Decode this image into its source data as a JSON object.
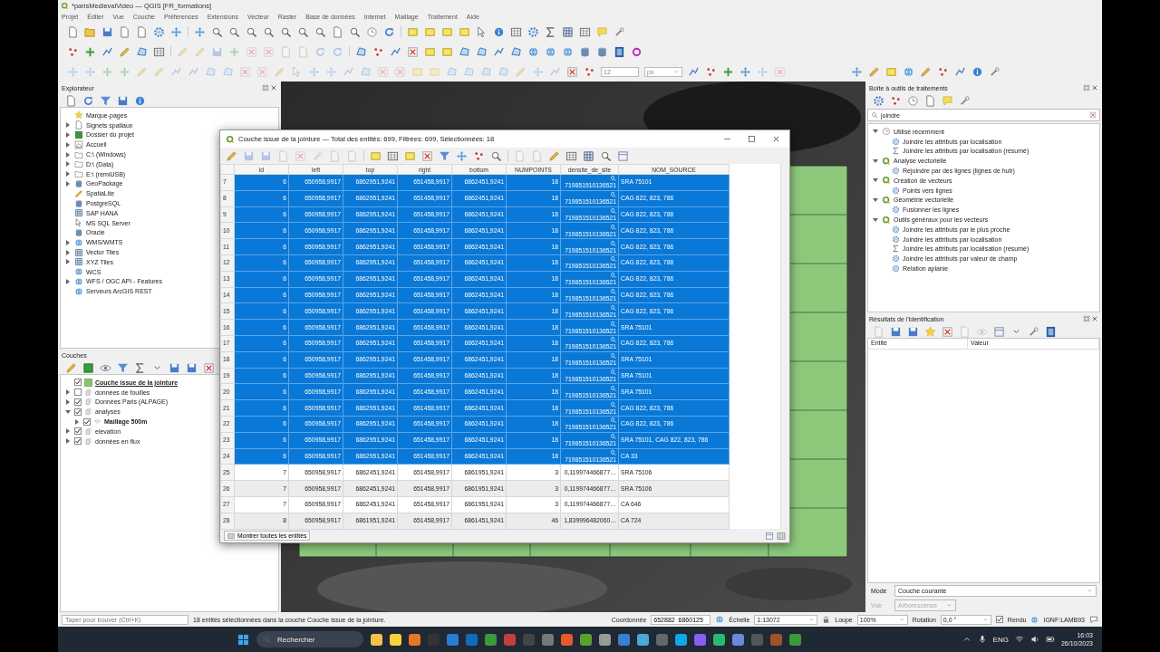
{
  "window": {
    "title": "*parisMedievalVideo — QGIS [FR_formations]"
  },
  "menu": [
    "Projet",
    "Éditer",
    "Vue",
    "Couche",
    "Préférences",
    "Extensions",
    "Vecteur",
    "Raster",
    "Base de données",
    "Internet",
    "Maillage",
    "Traitement",
    "Aide"
  ],
  "toolbar": {
    "size_value": "12",
    "unit": "px"
  },
  "browser": {
    "title": "Explorateur",
    "items": [
      {
        "label": "Marque-pages",
        "kind": "star"
      },
      {
        "label": "Signets spatiaux",
        "kind": "doc",
        "expanded": false
      },
      {
        "label": "Dossier du projet",
        "kind": "layer",
        "expanded": false
      },
      {
        "label": "Accueil",
        "kind": "home",
        "expanded": false
      },
      {
        "label": "C:\\ (Windows)",
        "kind": "drive",
        "expanded": false
      },
      {
        "label": "D:\\ (Data)",
        "kind": "drive",
        "expanded": false
      },
      {
        "label": "E:\\ (remiUSB)",
        "kind": "drive",
        "expanded": false
      },
      {
        "label": "GeoPackage",
        "kind": "db",
        "expanded": false
      },
      {
        "label": "SpatiaLite",
        "kind": "pencil"
      },
      {
        "label": "PostgreSQL",
        "kind": "db"
      },
      {
        "label": "SAP HANA",
        "kind": "grid"
      },
      {
        "label": "MS SQL Server",
        "kind": "cursor"
      },
      {
        "label": "Oracle",
        "kind": "db"
      },
      {
        "label": "WMS/WMTS",
        "kind": "globe",
        "expanded": false
      },
      {
        "label": "Vector Tiles",
        "kind": "grid",
        "expanded": false
      },
      {
        "label": "XYZ Tiles",
        "kind": "grid",
        "expanded": false
      },
      {
        "label": "WCS",
        "kind": "globe"
      },
      {
        "label": "WFS / OGC API - Features",
        "kind": "globe",
        "expanded": false
      },
      {
        "label": "Serveurs ArcGIS REST",
        "kind": "globe"
      }
    ]
  },
  "layers": {
    "title": "Couches",
    "items": [
      {
        "label": "Couche issue de la jointure",
        "kind": "fill",
        "checked": true,
        "selected": true
      },
      {
        "label": "données de fouilles",
        "kind": "group",
        "checked": false,
        "selected": false,
        "expanded": false
      },
      {
        "label": "Données Paris (ALPAGE)",
        "kind": "group",
        "checked": true,
        "selected": false,
        "expanded": false
      },
      {
        "label": "analyses",
        "kind": "group",
        "checked": true,
        "selected": false,
        "expanded": true,
        "children": [
          {
            "label": "Maillage 500m",
            "kind": "mesh",
            "checked": true,
            "selected": false,
            "bold": true,
            "expanded": false
          }
        ]
      },
      {
        "label": "elevation",
        "kind": "group",
        "checked": true,
        "selected": false,
        "expanded": false
      },
      {
        "label": "données en flux",
        "kind": "group",
        "checked": true,
        "selected": false,
        "expanded": false
      }
    ]
  },
  "attribute_table": {
    "title": "Couche issue de la jointure — Total des entités: 699, Filtrées: 699, Sélectionnées: 18",
    "columns": [
      "id",
      "left",
      "top",
      "right",
      "bottom",
      "NUMPOINTS",
      "densite_de_site",
      "NOM_SOURCE"
    ],
    "rows": [
      {
        "number": "7",
        "selected": true,
        "cells": [
          "6",
          "650958,9917",
          "6862951,9241",
          "651458,9917",
          "6862451,9241",
          "18",
          "0,719851510136521",
          "SRA 75101"
        ]
      },
      {
        "number": "8",
        "selected": true,
        "cells": [
          "6",
          "650958,9917",
          "6862951,9241",
          "651458,9917",
          "6862451,9241",
          "18",
          "0,719851510136521",
          "CAG 822, 823, 786"
        ]
      },
      {
        "number": "9",
        "selected": true,
        "cells": [
          "6",
          "650958,9917",
          "6862951,9241",
          "651458,9917",
          "6862451,9241",
          "18",
          "0,719851510136521",
          "CAG 822, 823, 786"
        ]
      },
      {
        "number": "10",
        "selected": true,
        "cells": [
          "6",
          "650958,9917",
          "6862951,9241",
          "651458,9917",
          "6862451,9241",
          "18",
          "0,719851510136521",
          "CAG 822, 823, 786"
        ]
      },
      {
        "number": "11",
        "selected": true,
        "cells": [
          "6",
          "650958,9917",
          "6862951,9241",
          "651458,9917",
          "6862451,9241",
          "18",
          "0,719851510136521",
          "CAG 822, 823, 786"
        ]
      },
      {
        "number": "12",
        "selected": true,
        "cells": [
          "6",
          "650958,9917",
          "6862951,9241",
          "651458,9917",
          "6862451,9241",
          "18",
          "0,719851510136521",
          "CAG 822, 823, 786"
        ]
      },
      {
        "number": "13",
        "selected": true,
        "cells": [
          "6",
          "650958,9917",
          "6862951,9241",
          "651458,9917",
          "6862451,9241",
          "18",
          "0,719851510136521",
          "CAG 822, 823, 786"
        ]
      },
      {
        "number": "14",
        "selected": true,
        "cells": [
          "6",
          "650958,9917",
          "6862951,9241",
          "651458,9917",
          "6862451,9241",
          "18",
          "0,719851510136521",
          "CAG 822, 823, 786"
        ]
      },
      {
        "number": "15",
        "selected": true,
        "cells": [
          "6",
          "650958,9917",
          "6862951,9241",
          "651458,9917",
          "6862451,9241",
          "18",
          "0,719851510136521",
          "CAG 822, 823, 786"
        ]
      },
      {
        "number": "16",
        "selected": true,
        "cells": [
          "6",
          "650958,9917",
          "6862951,9241",
          "651458,9917",
          "6862451,9241",
          "18",
          "0,719851510136521",
          "SRA 75101"
        ]
      },
      {
        "number": "17",
        "selected": true,
        "cells": [
          "6",
          "650958,9917",
          "6862951,9241",
          "651458,9917",
          "6862451,9241",
          "18",
          "0,719851510136521",
          "CAG 822, 823, 786"
        ]
      },
      {
        "number": "18",
        "selected": true,
        "cells": [
          "6",
          "650958,9917",
          "6862951,9241",
          "651458,9917",
          "6862451,9241",
          "18",
          "0,719851510136521",
          "SRA 75101"
        ]
      },
      {
        "number": "19",
        "selected": true,
        "cells": [
          "6",
          "650958,9917",
          "6862951,9241",
          "651458,9917",
          "6862451,9241",
          "18",
          "0,719851510136521",
          "SRA 75101"
        ]
      },
      {
        "number": "20",
        "selected": true,
        "cells": [
          "6",
          "650958,9917",
          "6862951,9241",
          "651458,9917",
          "6862451,9241",
          "18",
          "0,719851510136521",
          "SRA 75101"
        ]
      },
      {
        "number": "21",
        "selected": true,
        "cells": [
          "6",
          "650958,9917",
          "6862951,9241",
          "651458,9917",
          "6862451,9241",
          "18",
          "0,719851510136521",
          "CAG 822, 823, 786"
        ]
      },
      {
        "number": "22",
        "selected": true,
        "cells": [
          "6",
          "650958,9917",
          "6862951,9241",
          "651458,9917",
          "6862451,9241",
          "18",
          "0,719851510136521",
          "CAG 822, 823, 786"
        ]
      },
      {
        "number": "23",
        "selected": true,
        "cells": [
          "6",
          "650958,9917",
          "6862951,9241",
          "651458,9917",
          "6862451,9241",
          "18",
          "0,719851510136521",
          "SRA 75101, CAG 822, 823, 786"
        ]
      },
      {
        "number": "24",
        "selected": true,
        "cells": [
          "6",
          "650958,9917",
          "6862951,9241",
          "651458,9917",
          "6862451,9241",
          "18",
          "0,719851510136521",
          "CA 33"
        ]
      },
      {
        "number": "25",
        "selected": false,
        "cells": [
          "7",
          "650958,9917",
          "6862451,9241",
          "651458,9917",
          "6861951,9241",
          "3",
          "0,119974466877…",
          "SRA 75106"
        ]
      },
      {
        "number": "26",
        "selected": false,
        "cells": [
          "7",
          "650958,9917",
          "6862451,9241",
          "651458,9917",
          "6861951,9241",
          "3",
          "0,119974466877…",
          "SRA 75106"
        ]
      },
      {
        "number": "27",
        "selected": false,
        "cells": [
          "7",
          "650958,9917",
          "6862451,9241",
          "651458,9917",
          "6861951,9241",
          "3",
          "0,119974466877…",
          "CA 646"
        ]
      },
      {
        "number": "28",
        "selected": false,
        "cells": [
          "8",
          "650958,9917",
          "6861951,9241",
          "651458,9917",
          "6861451,9241",
          "46",
          "1,839996482060…",
          "CA 724"
        ]
      }
    ],
    "show_button": "Montrer toutes les entités"
  },
  "processing": {
    "title": "Boîte à outils de traitements",
    "search": {
      "value": "joindre"
    },
    "groups": [
      {
        "label": "Utilisé récemment",
        "kind": "clock",
        "expanded": true,
        "children": [
          {
            "label": "Joindre les attributs par localisation",
            "kind": "gear"
          },
          {
            "label": "Joindre les attributs par localisation (résumé)",
            "kind": "sigma"
          }
        ]
      },
      {
        "label": "Analyse vectorielle",
        "kind": "q",
        "expanded": true,
        "children": [
          {
            "label": "Rejoindre par des lignes (lignes de hub)",
            "kind": "gear"
          }
        ]
      },
      {
        "label": "Création de vecteurs",
        "kind": "q",
        "expanded": true,
        "children": [
          {
            "label": "Points vers lignes",
            "kind": "gear"
          }
        ]
      },
      {
        "label": "Géométrie vectorielle",
        "kind": "q",
        "expanded": true,
        "children": [
          {
            "label": "Fusionner les lignes",
            "kind": "gear"
          }
        ]
      },
      {
        "label": "Outils généraux pour les vecteurs",
        "kind": "q",
        "expanded": true,
        "children": [
          {
            "label": "Joindre les attributs par le plus proche",
            "kind": "gear"
          },
          {
            "label": "Joindre les attributs par localisation",
            "kind": "gear"
          },
          {
            "label": "Joindre les attributs par localisation (résumé)",
            "kind": "sigma"
          },
          {
            "label": "Joindre les attributs par valeur de champ",
            "kind": "gear"
          },
          {
            "label": "Relation aplanie",
            "kind": "gear"
          }
        ]
      }
    ]
  },
  "identify": {
    "title": "Résultats de l'identification",
    "columns": [
      "Entité",
      "Valeur"
    ],
    "mode_label": "Mode",
    "mode_value": "Couche courante",
    "view_label": "Vue",
    "view_value": "Arborescence",
    "view_disabled": true
  },
  "status_bar": {
    "search_placeholder": "Taper pour trouver (Ctrl+K)",
    "message": "18 entités sélectionnées dans la couche Couche issue de la jointure.",
    "coordinate_label": "Coordonnée",
    "coordinate": "652882  6860125",
    "scale_label": "Échelle",
    "scale": "1:13072",
    "magnifier_label": "Loupe",
    "magnifier": "100%",
    "rotation_label": "Rotation",
    "rotation": "0,0 °",
    "render_label": "Rendu",
    "render_checked": true,
    "crs": "IGNF:LAMB93"
  },
  "taskbar": {
    "search": "Rechercher",
    "language": "ENG",
    "time": "16:03",
    "date": "26/10/2023"
  }
}
